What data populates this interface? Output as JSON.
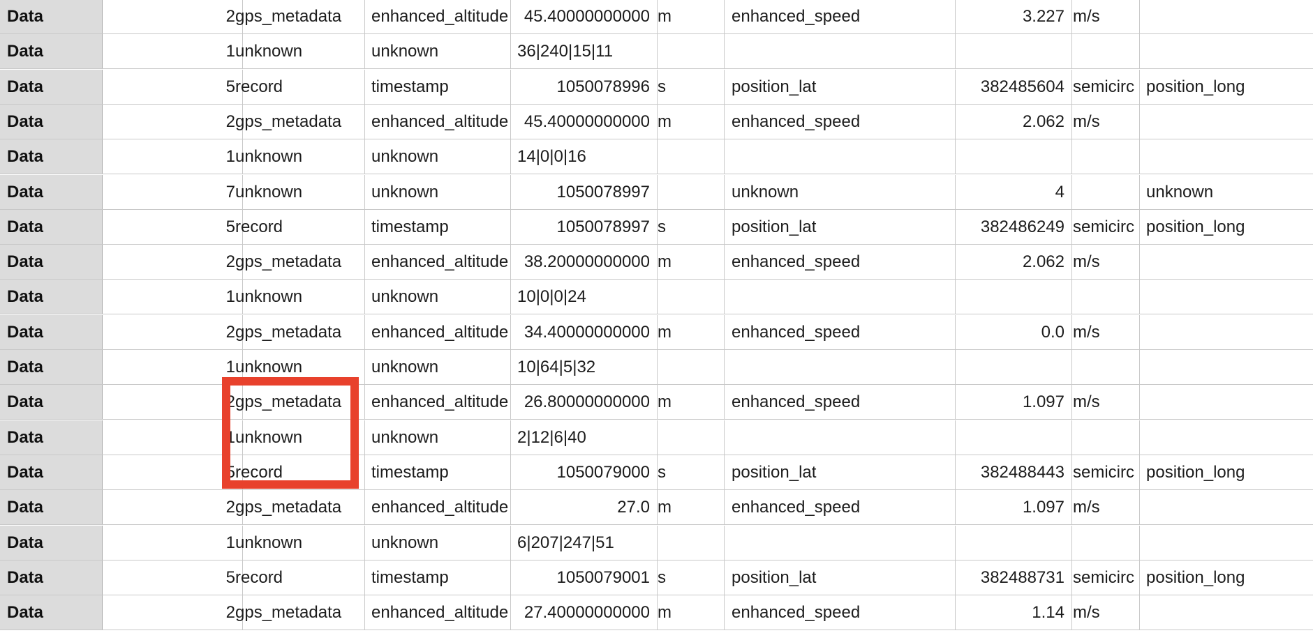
{
  "accent_color": "#e8412c",
  "rows": [
    {
      "type": "Data",
      "local": "2",
      "message": "gps_metadata",
      "field1": "enhanced_altitude",
      "value1": "45.40000000000",
      "units1": "m",
      "field2": "enhanced_speed",
      "value2": "3.227",
      "units2": "m/s",
      "field3": ""
    },
    {
      "type": "Data",
      "local": "1",
      "message": "unknown",
      "field1": "unknown",
      "value1": "36|240|15|11",
      "units1": "",
      "field2": "",
      "value2": "",
      "units2": "",
      "field3": ""
    },
    {
      "type": "Data",
      "local": "5",
      "message": "record",
      "field1": "timestamp",
      "value1": "1050078996",
      "units1": "s",
      "field2": "position_lat",
      "value2": "382485604",
      "units2": "semicirc",
      "field3": "position_long"
    },
    {
      "type": "Data",
      "local": "2",
      "message": "gps_metadata",
      "field1": "enhanced_altitude",
      "value1": "45.40000000000",
      "units1": "m",
      "field2": "enhanced_speed",
      "value2": "2.062",
      "units2": "m/s",
      "field3": ""
    },
    {
      "type": "Data",
      "local": "1",
      "message": "unknown",
      "field1": "unknown",
      "value1": "14|0|0|16",
      "units1": "",
      "field2": "",
      "value2": "",
      "units2": "",
      "field3": ""
    },
    {
      "type": "Data",
      "local": "7",
      "message": "unknown",
      "field1": "unknown",
      "value1": "1050078997",
      "units1": "",
      "field2": "unknown",
      "value2": "4",
      "units2": "",
      "field3": "unknown"
    },
    {
      "type": "Data",
      "local": "5",
      "message": "record",
      "field1": "timestamp",
      "value1": "1050078997",
      "units1": "s",
      "field2": "position_lat",
      "value2": "382486249",
      "units2": "semicirc",
      "field3": "position_long"
    },
    {
      "type": "Data",
      "local": "2",
      "message": "gps_metadata",
      "field1": "enhanced_altitude",
      "value1": "38.20000000000",
      "units1": "m",
      "field2": "enhanced_speed",
      "value2": "2.062",
      "units2": "m/s",
      "field3": ""
    },
    {
      "type": "Data",
      "local": "1",
      "message": "unknown",
      "field1": "unknown",
      "value1": "10|0|0|24",
      "units1": "",
      "field2": "",
      "value2": "",
      "units2": "",
      "field3": ""
    },
    {
      "type": "Data",
      "local": "2",
      "message": "gps_metadata",
      "field1": "enhanced_altitude",
      "value1": "34.40000000000",
      "units1": "m",
      "field2": "enhanced_speed",
      "value2": "0.0",
      "units2": "m/s",
      "field3": ""
    },
    {
      "type": "Data",
      "local": "1",
      "message": "unknown",
      "field1": "unknown",
      "value1": "10|64|5|32",
      "units1": "",
      "field2": "",
      "value2": "",
      "units2": "",
      "field3": ""
    },
    {
      "type": "Data",
      "local": "2",
      "message": "gps_metadata",
      "field1": "enhanced_altitude",
      "value1": "26.80000000000",
      "units1": "m",
      "field2": "enhanced_speed",
      "value2": "1.097",
      "units2": "m/s",
      "field3": ""
    },
    {
      "type": "Data",
      "local": "1",
      "message": "unknown",
      "field1": "unknown",
      "value1": "2|12|6|40",
      "units1": "",
      "field2": "",
      "value2": "",
      "units2": "",
      "field3": ""
    },
    {
      "type": "Data",
      "local": "5",
      "message": "record",
      "field1": "timestamp",
      "value1": "1050079000",
      "units1": "s",
      "field2": "position_lat",
      "value2": "382488443",
      "units2": "semicirc",
      "field3": "position_long"
    },
    {
      "type": "Data",
      "local": "2",
      "message": "gps_metadata",
      "field1": "enhanced_altitude",
      "value1": "27.0",
      "units1": "m",
      "field2": "enhanced_speed",
      "value2": "1.097",
      "units2": "m/s",
      "field3": ""
    },
    {
      "type": "Data",
      "local": "1",
      "message": "unknown",
      "field1": "unknown",
      "value1": "6|207|247|51",
      "units1": "",
      "field2": "",
      "value2": "",
      "units2": "",
      "field3": ""
    },
    {
      "type": "Data",
      "local": "5",
      "message": "record",
      "field1": "timestamp",
      "value1": "1050079001",
      "units1": "s",
      "field2": "position_lat",
      "value2": "382488731",
      "units2": "semicirc",
      "field3": "position_long"
    },
    {
      "type": "Data",
      "local": "2",
      "message": "gps_metadata",
      "field1": "enhanced_altitude",
      "value1": "27.40000000000",
      "units1": "m",
      "field2": "enhanced_speed",
      "value2": "1.14",
      "units2": "m/s",
      "field3": ""
    }
  ]
}
